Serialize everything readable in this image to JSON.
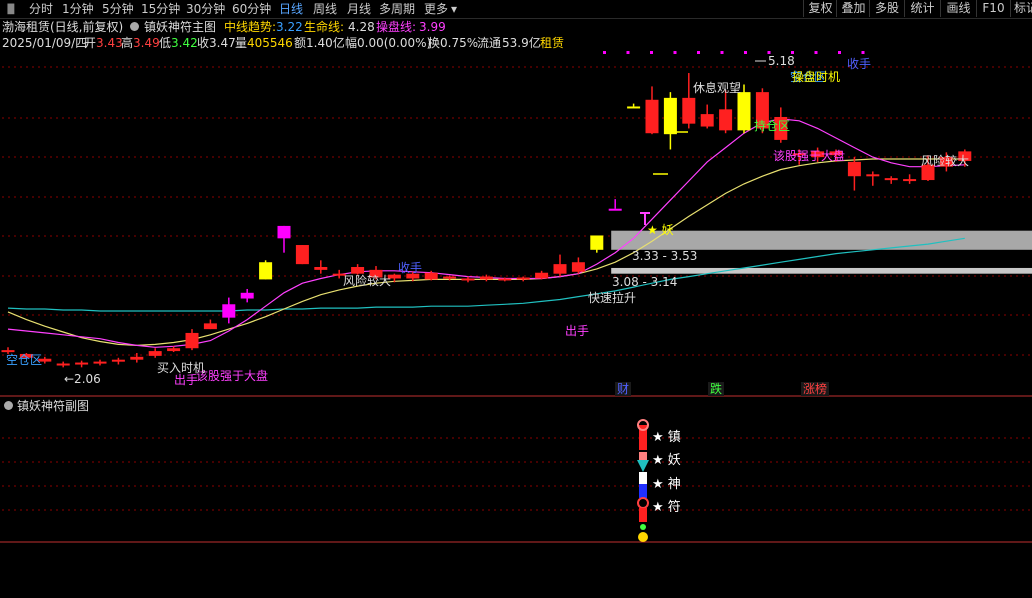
{
  "tabs": [
    "分时",
    "1分钟",
    "5分钟",
    "15分钟",
    "30分钟",
    "60分钟",
    "日线",
    "周线",
    "月线",
    "多周期",
    "更多"
  ],
  "active_tab": "日线",
  "right_tabs": [
    "复权",
    "叠加",
    "多股",
    "统计",
    "画线",
    "F10",
    "标记"
  ],
  "title": {
    "stock_name": "渤海租赁(日线,前复权)",
    "indicator_name": "镇妖神符主图",
    "mid_trend_label": "中线趋势:",
    "mid_trend_value": "3.22",
    "life_line_label": "生命线:",
    "life_line_value": "4.28",
    "trade_line_label": "操盘线:",
    "trade_line_value": "3.99"
  },
  "quote": {
    "date": "2025/01/09/四",
    "open_label": "开",
    "open": "3.43",
    "high_label": "高",
    "high": "3.49",
    "low_label": "低",
    "low": "3.42",
    "close_label": "收",
    "close": "3.47",
    "volume_label": "量",
    "volume": "405546",
    "amount_label": "额",
    "amount": "1.40亿",
    "change_label": "幅",
    "change": "0.00(0.00%)",
    "turnover_label": "换",
    "turnover": "0.75%",
    "float_label": "流通",
    "float_cap": "53.9亿",
    "sector": "租赁"
  },
  "sub_title": "镇妖神符副图",
  "colors": {
    "up": "#ff2020",
    "down": "#ff2020",
    "yellow": "#ffff00",
    "magenta": "#ff00ff",
    "cyan": "#20c0c0",
    "mid_line": "#e8e070",
    "trade_line": "#ff40ff",
    "blue_text": "#5060ff",
    "gray_band": "#a8a8a8"
  },
  "chart_data": {
    "type": "candlestick",
    "y_range": [
      1.8,
      5.4
    ],
    "candles": [
      {
        "o": 2.28,
        "h": 2.31,
        "l": 2.24,
        "c": 2.26,
        "kind": "red"
      },
      {
        "o": 2.24,
        "h": 2.25,
        "l": 2.19,
        "c": 2.2,
        "kind": "red"
      },
      {
        "o": 2.19,
        "h": 2.21,
        "l": 2.14,
        "c": 2.16,
        "kind": "red"
      },
      {
        "o": 2.14,
        "h": 2.16,
        "l": 2.1,
        "c": 2.13,
        "kind": "red"
      },
      {
        "o": 2.13,
        "h": 2.17,
        "l": 2.1,
        "c": 2.15,
        "kind": "red"
      },
      {
        "o": 2.15,
        "h": 2.18,
        "l": 2.12,
        "c": 2.16,
        "kind": "red"
      },
      {
        "o": 2.16,
        "h": 2.2,
        "l": 2.13,
        "c": 2.18,
        "kind": "red"
      },
      {
        "o": 2.18,
        "h": 2.25,
        "l": 2.15,
        "c": 2.21,
        "kind": "red"
      },
      {
        "o": 2.22,
        "h": 2.3,
        "l": 2.2,
        "c": 2.27,
        "kind": "red"
      },
      {
        "o": 2.27,
        "h": 2.32,
        "l": 2.26,
        "c": 2.3,
        "kind": "red"
      },
      {
        "o": 2.3,
        "h": 2.5,
        "l": 2.28,
        "c": 2.46,
        "kind": "red"
      },
      {
        "o": 2.5,
        "h": 2.6,
        "l": 2.5,
        "c": 2.56,
        "kind": "red"
      },
      {
        "o": 2.62,
        "h": 2.83,
        "l": 2.56,
        "c": 2.76,
        "kind": "magenta"
      },
      {
        "o": 2.82,
        "h": 2.92,
        "l": 2.78,
        "c": 2.88,
        "kind": "magenta"
      },
      {
        "o": 3.02,
        "h": 3.22,
        "l": 3.02,
        "c": 3.2,
        "kind": "yellow"
      },
      {
        "o": 3.45,
        "h": 3.58,
        "l": 3.3,
        "c": 3.58,
        "kind": "magenta"
      },
      {
        "o": 3.38,
        "h": 3.38,
        "l": 3.18,
        "c": 3.18,
        "kind": "red"
      },
      {
        "o": 3.15,
        "h": 3.22,
        "l": 3.08,
        "c": 3.12,
        "kind": "red"
      },
      {
        "o": 3.08,
        "h": 3.12,
        "l": 3.03,
        "c": 3.07,
        "kind": "red"
      },
      {
        "o": 3.15,
        "h": 3.18,
        "l": 3.07,
        "c": 3.08,
        "kind": "red"
      },
      {
        "o": 3.12,
        "h": 3.16,
        "l": 3.02,
        "c": 3.04,
        "kind": "red"
      },
      {
        "o": 3.07,
        "h": 3.08,
        "l": 2.99,
        "c": 3.03,
        "kind": "red"
      },
      {
        "o": 3.08,
        "h": 3.1,
        "l": 3.0,
        "c": 3.03,
        "kind": "red"
      },
      {
        "o": 3.09,
        "h": 3.11,
        "l": 3.01,
        "c": 3.02,
        "kind": "red"
      },
      {
        "o": 3.05,
        "h": 3.06,
        "l": 3.01,
        "c": 3.03,
        "kind": "red"
      },
      {
        "o": 3.03,
        "h": 3.05,
        "l": 2.99,
        "c": 3.02,
        "kind": "red"
      },
      {
        "o": 3.05,
        "h": 3.07,
        "l": 3.0,
        "c": 3.02,
        "kind": "red"
      },
      {
        "o": 3.03,
        "h": 3.04,
        "l": 3.0,
        "c": 3.02,
        "kind": "red"
      },
      {
        "o": 3.04,
        "h": 3.05,
        "l": 3.0,
        "c": 3.02,
        "kind": "red"
      },
      {
        "o": 3.09,
        "h": 3.11,
        "l": 3.02,
        "c": 3.03,
        "kind": "red"
      },
      {
        "o": 3.18,
        "h": 3.28,
        "l": 3.05,
        "c": 3.08,
        "kind": "red"
      },
      {
        "o": 3.2,
        "h": 3.25,
        "l": 3.08,
        "c": 3.1,
        "kind": "red"
      },
      {
        "o": 3.33,
        "h": 3.38,
        "l": 3.3,
        "c": 3.48,
        "kind": "yellow"
      },
      {
        "o": 3.76,
        "h": 3.86,
        "l": 3.76,
        "c": 3.76,
        "kind": "magenta"
      },
      {
        "o": 4.83,
        "h": 4.86,
        "l": 4.83,
        "c": 4.83,
        "kind": "yellow"
      },
      {
        "o": 4.9,
        "h": 5.04,
        "l": 4.54,
        "c": 4.55,
        "kind": "red"
      },
      {
        "o": 4.92,
        "h": 4.98,
        "l": 4.38,
        "c": 4.54,
        "kind": "yellow"
      },
      {
        "o": 4.92,
        "h": 5.18,
        "l": 4.6,
        "c": 4.65,
        "kind": "red"
      },
      {
        "o": 4.75,
        "h": 4.85,
        "l": 4.6,
        "c": 4.62,
        "kind": "red"
      },
      {
        "o": 4.8,
        "h": 5.0,
        "l": 4.55,
        "c": 4.58,
        "kind": "red"
      },
      {
        "o": 4.98,
        "h": 5.06,
        "l": 4.55,
        "c": 4.58,
        "kind": "yellow"
      },
      {
        "o": 4.98,
        "h": 5.02,
        "l": 4.55,
        "c": 4.6,
        "kind": "red"
      },
      {
        "o": 4.72,
        "h": 4.82,
        "l": 4.45,
        "c": 4.48,
        "kind": "red"
      },
      {
        "o": 4.34,
        "h": 4.38,
        "l": 4.22,
        "c": 4.33,
        "kind": "red"
      },
      {
        "o": 4.36,
        "h": 4.4,
        "l": 4.25,
        "c": 4.3,
        "kind": "red"
      },
      {
        "o": 4.36,
        "h": 4.38,
        "l": 4.25,
        "c": 4.32,
        "kind": "red"
      },
      {
        "o": 4.25,
        "h": 4.3,
        "l": 3.95,
        "c": 4.1,
        "kind": "red"
      },
      {
        "o": 4.12,
        "h": 4.15,
        "l": 4.0,
        "c": 4.1,
        "kind": "red"
      },
      {
        "o": 4.06,
        "h": 4.1,
        "l": 4.02,
        "c": 4.08,
        "kind": "red"
      },
      {
        "o": 4.05,
        "h": 4.12,
        "l": 4.02,
        "c": 4.07,
        "kind": "red"
      },
      {
        "o": 4.06,
        "h": 4.32,
        "l": 4.05,
        "c": 4.22,
        "kind": "red"
      },
      {
        "o": 4.3,
        "h": 4.35,
        "l": 4.15,
        "c": 4.2,
        "kind": "red"
      },
      {
        "o": 4.36,
        "h": 4.38,
        "l": 4.2,
        "c": 4.26,
        "kind": "red"
      }
    ],
    "lines": {
      "trade_line": [
        2.5,
        2.48,
        2.46,
        2.44,
        2.42,
        2.4,
        2.36,
        2.33,
        2.31,
        2.32,
        2.34,
        2.38,
        2.48,
        2.6,
        2.74,
        2.88,
        2.98,
        3.03,
        3.07,
        3.1,
        3.11,
        3.11,
        3.1,
        3.09,
        3.07,
        3.05,
        3.04,
        3.03,
        3.03,
        3.03,
        3.05,
        3.08,
        3.18,
        3.3,
        3.45,
        3.65,
        3.85,
        4.05,
        4.25,
        4.4,
        4.55,
        4.66,
        4.7,
        4.68,
        4.6,
        4.5,
        4.4,
        4.3,
        4.24,
        4.2,
        4.2,
        4.21,
        4.22
      ],
      "mid_trend": [
        2.68,
        2.6,
        2.53,
        2.47,
        2.41,
        2.37,
        2.34,
        2.33,
        2.34,
        2.36,
        2.39,
        2.44,
        2.5,
        2.56,
        2.63,
        2.71,
        2.79,
        2.86,
        2.91,
        2.95,
        2.98,
        3.0,
        3.01,
        3.02,
        3.02,
        3.02,
        3.02,
        3.02,
        3.02,
        3.03,
        3.05,
        3.08,
        3.13,
        3.2,
        3.3,
        3.42,
        3.55,
        3.68,
        3.8,
        3.92,
        4.02,
        4.1,
        4.17,
        4.21,
        4.24,
        4.26,
        4.27,
        4.28,
        4.28,
        4.28,
        4.28,
        4.28,
        4.28
      ],
      "life_line": [
        2.72,
        2.71,
        2.71,
        2.7,
        2.7,
        2.69,
        2.69,
        2.69,
        2.69,
        2.69,
        2.69,
        2.69,
        2.69,
        2.7,
        2.7,
        2.71,
        2.71,
        2.72,
        2.72,
        2.72,
        2.73,
        2.73,
        2.73,
        2.74,
        2.74,
        2.74,
        2.75,
        2.76,
        2.77,
        2.79,
        2.81,
        2.84,
        2.87,
        2.9,
        2.94,
        2.98,
        3.02,
        3.05,
        3.08,
        3.11,
        3.14,
        3.17,
        3.2,
        3.23,
        3.26,
        3.29,
        3.31,
        3.33,
        3.35,
        3.37,
        3.39,
        3.42,
        3.45
      ]
    },
    "price_labels": [
      "5.18",
      "2.06",
      "3.33 - 3.53",
      "3.08 - 3.14"
    ],
    "annotations": [
      "休息观望",
      "空仓区",
      "持仓区",
      "操盘时机",
      "收手",
      "风险较大",
      "该股强于大盘",
      "空仓区",
      "买入时机",
      "出手",
      "快速拉升",
      "出手",
      "★ 妖"
    ],
    "bottom_labels": [
      "财",
      "跌",
      "涨榜"
    ],
    "sub_chart_labels": [
      "★ 镇",
      "★ 妖",
      "★ 神",
      "★ 符"
    ]
  }
}
